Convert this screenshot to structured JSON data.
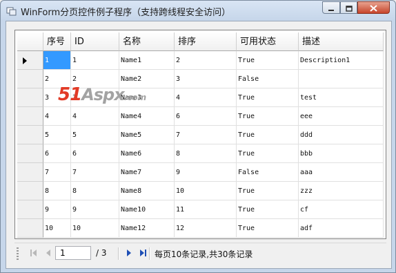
{
  "window": {
    "title": "WinForm分页控件例子程序（支持跨线程安全访问）"
  },
  "grid": {
    "columns": [
      "序号",
      "ID",
      "名称",
      "排序",
      "可用状态",
      "描述"
    ],
    "rows": [
      [
        "1",
        "1",
        "Name1",
        "2",
        "True",
        "Description1"
      ],
      [
        "2",
        "2",
        "Name2",
        "3",
        "False",
        ""
      ],
      [
        "3",
        "3",
        "Name3",
        "4",
        "True",
        "test"
      ],
      [
        "4",
        "4",
        "Name4",
        "6",
        "True",
        "eee"
      ],
      [
        "5",
        "5",
        "Name5",
        "7",
        "True",
        "ddd"
      ],
      [
        "6",
        "6",
        "Name6",
        "8",
        "True",
        "bbb"
      ],
      [
        "7",
        "7",
        "Name7",
        "9",
        "False",
        "aaa"
      ],
      [
        "8",
        "8",
        "Name8",
        "10",
        "True",
        "zzz"
      ],
      [
        "9",
        "9",
        "Name10",
        "11",
        "True",
        "cf"
      ],
      [
        "10",
        "10",
        "Name12",
        "12",
        "True",
        "adf"
      ]
    ],
    "selected_row": 0
  },
  "watermark": {
    "part1": "51",
    "part2": "Aspx",
    "part3": ".com"
  },
  "pager": {
    "current_page": "1",
    "total_pages": "/ 3",
    "info": "每页10条记录,共30条记录"
  },
  "colors": {
    "selection": "#3399ff",
    "watermark_red": "#e23a26",
    "nav_blue": "#1f4fb5"
  },
  "icons": [
    "app-icon",
    "minimize-icon",
    "maximize-icon",
    "close-icon",
    "first-page-icon",
    "prev-page-icon",
    "next-page-icon",
    "last-page-icon",
    "current-row-arrow-icon"
  ]
}
